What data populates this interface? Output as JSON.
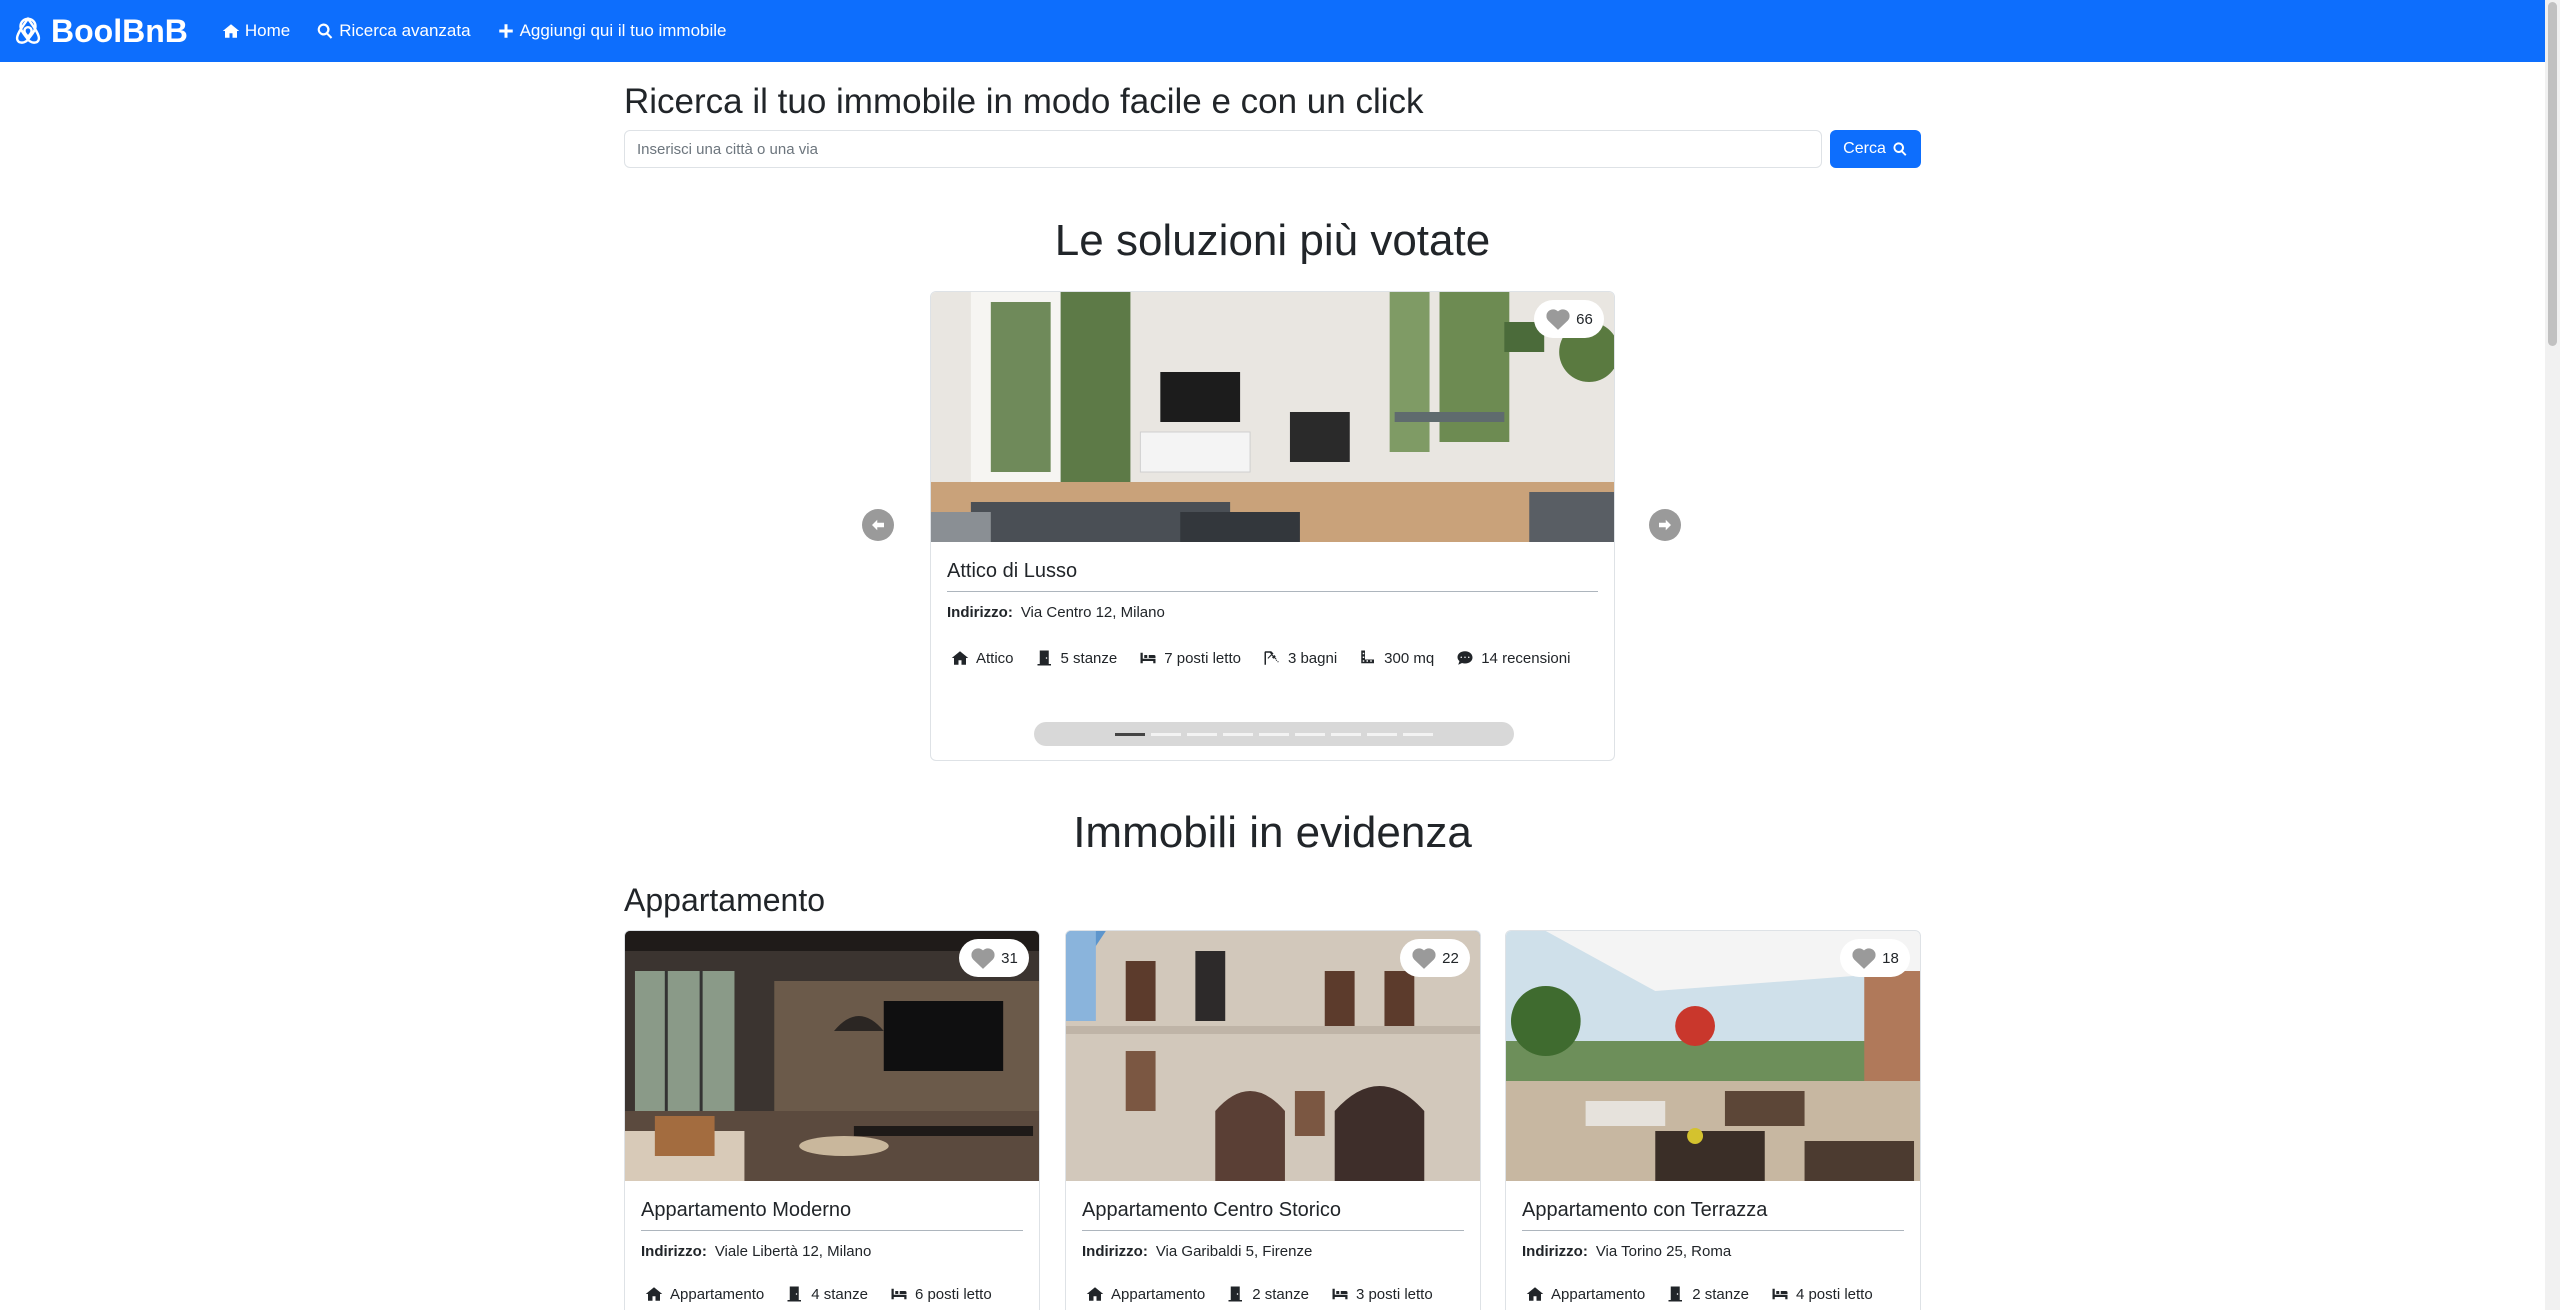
{
  "navbar": {
    "brand": "BoolBnB",
    "links": [
      "Home",
      "Ricerca avanzata",
      "Aggiungi qui il tuo immobile"
    ]
  },
  "search": {
    "title": "Ricerca il tuo immobile in modo facile e con un click",
    "placeholder": "Inserisci una città o una via",
    "button": "Cerca"
  },
  "top_rated": {
    "title": "Le soluzioni più votate",
    "card": {
      "likes": "66",
      "name": "Attico di Lusso",
      "address_label": "Indirizzo:",
      "address": "Via Centro 12, Milano",
      "type": "Attico",
      "rooms": "5 stanze",
      "beds": "7 posti letto",
      "baths": "3 bagni",
      "sqm": "300 mq",
      "reviews": "14 recensioni"
    },
    "slides": 9,
    "active_slide": 1
  },
  "featured": {
    "title": "Immobili in evidenza",
    "category": "Appartamento",
    "cards": [
      {
        "likes": "31",
        "name": "Appartamento Moderno",
        "address_label": "Indirizzo:",
        "address": "Viale Libertà 12, Milano",
        "type": "Appartamento",
        "rooms": "4 stanze",
        "beds": "6 posti letto"
      },
      {
        "likes": "22",
        "name": "Appartamento Centro Storico",
        "address_label": "Indirizzo:",
        "address": "Via Garibaldi 5, Firenze",
        "type": "Appartamento",
        "rooms": "2 stanze",
        "beds": "3 posti letto"
      },
      {
        "likes": "18",
        "name": "Appartamento con Terrazza",
        "address_label": "Indirizzo:",
        "address": "Via Torino 25, Roma",
        "type": "Appartamento",
        "rooms": "2 stanze",
        "beds": "4 posti letto"
      }
    ]
  },
  "colors": {
    "primary": "#0d6efd",
    "text": "#212529"
  }
}
